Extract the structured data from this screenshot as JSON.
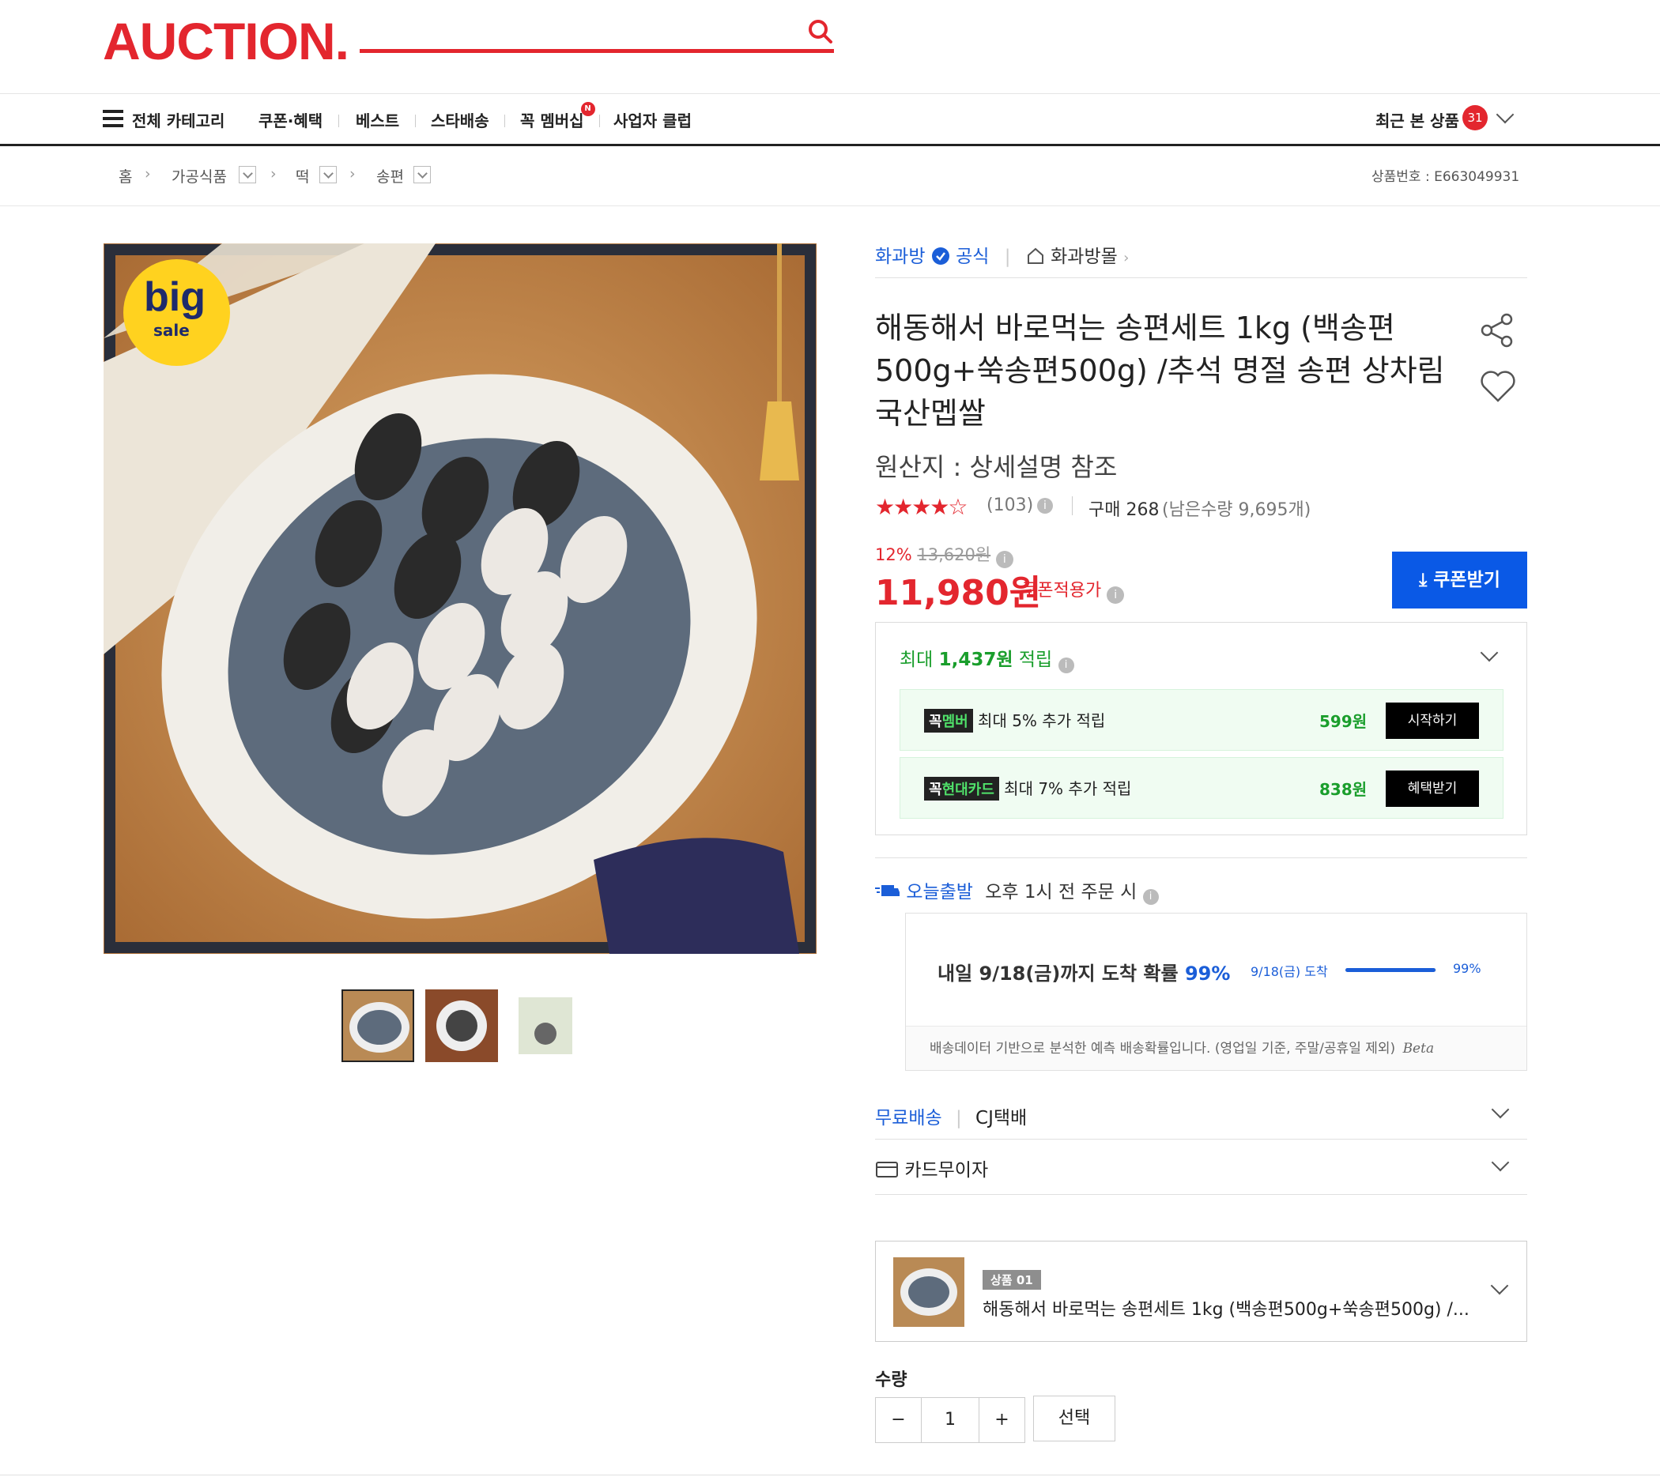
{
  "header": {
    "logo": "AUCTION.",
    "search_placeholder": ""
  },
  "nav": {
    "all_categories": "전체 카테고리",
    "items": [
      "쿠폰·혜택",
      "베스트",
      "스타배송",
      "꼭 멤버십",
      "사업자 클럽"
    ],
    "membership_badge": "N",
    "recent_label": "최근 본 상품",
    "recent_count": "31"
  },
  "breadcrumb": {
    "home": "홈",
    "levels": [
      "가공식품",
      "떡",
      "송편"
    ],
    "product_no_label": "상품번호 : E663049931"
  },
  "gallery": {
    "badge_big": "big",
    "badge_sale": "sale",
    "thumbnails": [
      "thumb-1",
      "thumb-2",
      "thumb-3"
    ],
    "selected_index": 0
  },
  "product": {
    "seller": "화과방",
    "official": "공식",
    "store": "화과방몰",
    "title": "해동해서 바로먹는 송편세트 1kg (백송편500g+쑥송편500g) /추석 명절 송편 상차림 국산멥쌀",
    "origin": "원산지 : 상세설명 참조",
    "rating": 4.5,
    "stars": "★★★★☆",
    "review_count": "(103)",
    "purchase": "구매 268",
    "remaining": "(남은수량 9,695개)",
    "discount": "12%",
    "original_price": "13,620원",
    "price": "11,980원",
    "price_note": "쿠폰적용가",
    "coupon_button": "쿠폰받기"
  },
  "rewards": {
    "max_prefix": "최대 ",
    "max_amount": "1,437원",
    "max_suffix": " 적립",
    "rows": [
      {
        "tag_prefix": "꼭",
        "tag_name": "멤버",
        "text": "최대 5% 추가 적립",
        "amount": "599원",
        "button": "시작하기"
      },
      {
        "tag_prefix": "꼭",
        "tag_name": "현대카드",
        "text": "최대 7% 추가 적립",
        "amount": "838원",
        "button": "혜택받기"
      }
    ]
  },
  "shipping": {
    "today_label": "오늘출발",
    "today_cond": "오후 1시 전 주문 시",
    "arrival_text": "내일 9/18(금)까지 도착 확률",
    "arrival_pct": "99%",
    "bar_label": "9/18(금) 도착",
    "bar_pct": "99%",
    "bar_value": 0.99,
    "footer": "배송데이터 기반으로 분석한 예측 배송확률입니다. (영업일 기준, 주말/공휴일 제외)",
    "beta": "Beta",
    "free_label": "무료배송",
    "courier": "CJ택배",
    "card_label": "카드무이자"
  },
  "option": {
    "tag": "상품 01",
    "name": "해동해서 바로먹는 송편세트 1kg (백송편500g+쑥송편500g) /..."
  },
  "quantity": {
    "label": "수량",
    "minus": "−",
    "value": "1",
    "plus": "+",
    "select_button": "선택"
  },
  "colors": {
    "brand_red": "#e3262e",
    "link_blue": "#1b5ed8",
    "coupon_blue": "#0a59e6",
    "reward_green": "#1a9e2c"
  }
}
